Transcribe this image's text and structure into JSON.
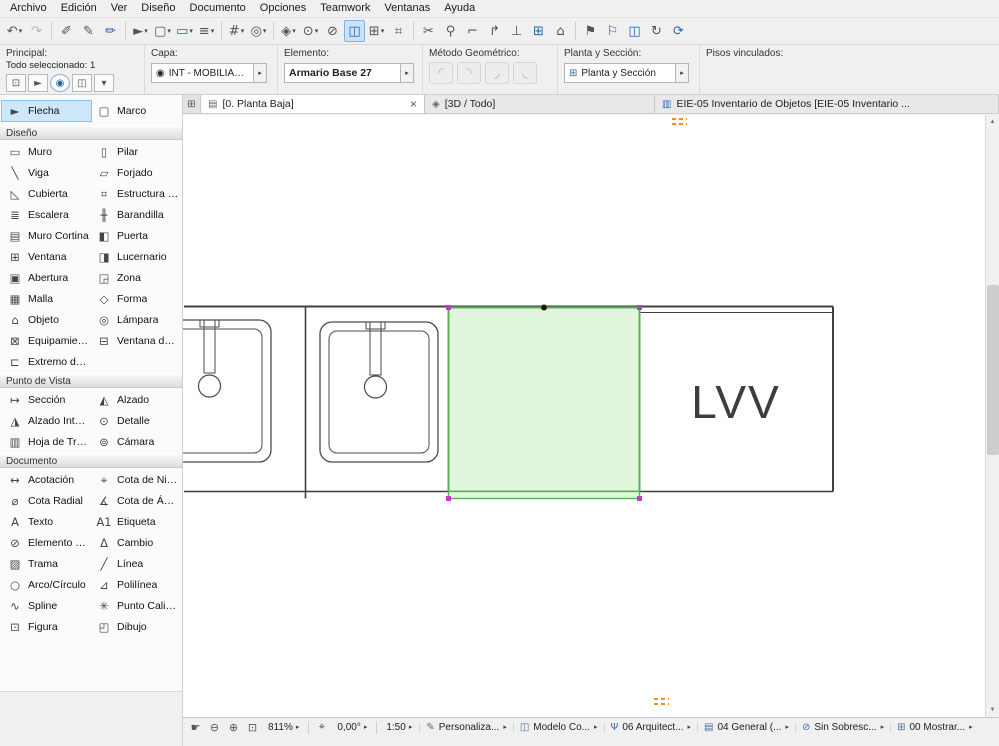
{
  "ui": {
    "caret_down": "▾",
    "caret_right": "▸",
    "close": "×",
    "scroll_up": "▲",
    "scroll_down": "▼"
  },
  "colors": {
    "selection_fill": "#E2F6DE",
    "selection_stroke": "#57AF57",
    "handle": "#C937C9",
    "toolbar_accent": "#2464a4",
    "story_marker": "#FF8C1A"
  },
  "menu": {
    "items": [
      {
        "name": "menu-archivo",
        "label": "Archivo"
      },
      {
        "name": "menu-edicion",
        "label": "Edición"
      },
      {
        "name": "menu-ver",
        "label": "Ver"
      },
      {
        "name": "menu-diseno",
        "label": "Diseño"
      },
      {
        "name": "menu-documento",
        "label": "Documento"
      },
      {
        "name": "menu-opciones",
        "label": "Opciones"
      },
      {
        "name": "menu-teamwork",
        "label": "Teamwork"
      },
      {
        "name": "menu-ventanas",
        "label": "Ventanas"
      },
      {
        "name": "menu-ayuda",
        "label": "Ayuda"
      }
    ]
  },
  "toolbar": {
    "groups": [
      [
        {
          "name": "undo-button",
          "glyph": "↶",
          "dd": true
        },
        {
          "name": "redo-button",
          "glyph": "↷",
          "dim": true
        }
      ],
      [
        {
          "name": "pick-up-parameters-button",
          "glyph": "✐"
        },
        {
          "name": "inject-parameters-button",
          "glyph": "✎"
        },
        {
          "name": "favorites-button",
          "glyph": "✏",
          "blue": true
        }
      ],
      [
        {
          "name": "arrow-tool-button",
          "glyph": "►",
          "dd": true
        },
        {
          "name": "marquee-tool-button",
          "glyph": "▢",
          "dd": true
        },
        {
          "name": "wall-tool-button",
          "glyph": "▭",
          "dd": true,
          "blue": true
        },
        {
          "name": "layer-settings-button",
          "glyph": "≡",
          "dd": true
        }
      ],
      [
        {
          "name": "grid-snap-button",
          "glyph": "#",
          "dd": true
        },
        {
          "name": "gravity-button",
          "glyph": "◎",
          "dd": true
        }
      ],
      [
        {
          "name": "projection-button",
          "glyph": "◈",
          "dd": true
        },
        {
          "name": "zoom-selection-button",
          "glyph": "⊙",
          "dd": true
        },
        {
          "name": "suspend-groups-button",
          "glyph": "⊘"
        },
        {
          "name": "element-snap-button",
          "glyph": "◫",
          "blue": true,
          "active": true
        },
        {
          "name": "guide-lines-button",
          "glyph": "⊞",
          "dd": true
        },
        {
          "name": "snap-reference-button",
          "glyph": "⌗"
        }
      ],
      [
        {
          "name": "split-button",
          "glyph": "✂"
        },
        {
          "name": "stretch-button",
          "glyph": "⚲"
        },
        {
          "name": "fillet-button",
          "glyph": "⌐"
        },
        {
          "name": "adjust-button",
          "glyph": "↱"
        },
        {
          "name": "intersect-button",
          "glyph": "⊥"
        },
        {
          "name": "new-window-button",
          "glyph": "⊞",
          "blue": true
        },
        {
          "name": "home-story-button",
          "glyph": "⌂"
        }
      ],
      [
        {
          "name": "flag-start-button",
          "glyph": "⚑"
        },
        {
          "name": "flag-review-button",
          "glyph": "⚐",
          "blue": true
        },
        {
          "name": "panel-toggle-button",
          "glyph": "◫",
          "blue": true
        },
        {
          "name": "rotate-view-button",
          "glyph": "↻"
        },
        {
          "name": "rebuild-button",
          "glyph": "⟳",
          "blue": true
        }
      ]
    ]
  },
  "infobar": {
    "principal": {
      "label": "Principal:",
      "selection": "Todo seleccionado: 1",
      "buttons": [
        {
          "name": "settings-dialog-button",
          "glyph": "⊡"
        },
        {
          "name": "pick-up-settings-button",
          "glyph": "►"
        },
        {
          "name": "default-settings-button",
          "glyph": "◉",
          "round": true
        },
        {
          "name": "favorites-popup-button",
          "glyph": "◫"
        },
        {
          "name": "more-options-button",
          "glyph": "▾"
        }
      ]
    },
    "capa": {
      "label": "Capa:",
      "icon": "◉",
      "value": "INT - MOBILIARIO FIJO.I..."
    },
    "elemento": {
      "label": "Elemento:",
      "value": "Armario Base 27"
    },
    "metodo": {
      "label": "Método Geométrico:",
      "buttons": [
        {
          "name": "geometry-method-1-button",
          "glyph": "◜"
        },
        {
          "name": "geometry-method-2-button",
          "glyph": "◝"
        },
        {
          "name": "geometry-method-3-button",
          "glyph": "◞"
        },
        {
          "name": "geometry-method-4-button",
          "glyph": "◟"
        }
      ]
    },
    "planta": {
      "label": "Planta y Sección:",
      "icon": "⊞",
      "value": "Planta y Sección"
    },
    "pisos": {
      "label": "Pisos vinculados:"
    }
  },
  "toolbox": {
    "top_tools": [
      {
        "name": "tool-flecha",
        "glyph": "►",
        "label": "Flecha",
        "selected": true
      },
      {
        "name": "tool-marco",
        "glyph": "▢",
        "label": "Marco"
      }
    ],
    "sections": [
      {
        "title": "Diseño",
        "tools": [
          {
            "name": "tool-muro",
            "glyph": "▭",
            "label": "Muro"
          },
          {
            "name": "tool-pilar",
            "glyph": "▯",
            "label": "Pilar"
          },
          {
            "name": "tool-viga",
            "glyph": "╲",
            "label": "Viga"
          },
          {
            "name": "tool-forjado",
            "glyph": "▱",
            "label": "Forjado"
          },
          {
            "name": "tool-cubierta",
            "glyph": "◺",
            "label": "Cubierta"
          },
          {
            "name": "tool-estructura-compleja",
            "glyph": "⌗",
            "label": "Estructura C..."
          },
          {
            "name": "tool-escalera",
            "glyph": "≣",
            "label": "Escalera"
          },
          {
            "name": "tool-barandilla",
            "glyph": "╫",
            "label": "Barandilla"
          },
          {
            "name": "tool-muro-cortina",
            "glyph": "▤",
            "label": "Muro Cortina"
          },
          {
            "name": "tool-puerta",
            "glyph": "◧",
            "label": "Puerta"
          },
          {
            "name": "tool-ventana",
            "glyph": "⊞",
            "label": "Ventana"
          },
          {
            "name": "tool-lucernario",
            "glyph": "◨",
            "label": "Lucernario"
          },
          {
            "name": "tool-abertura",
            "glyph": "▣",
            "label": "Abertura"
          },
          {
            "name": "tool-zona",
            "glyph": "◲",
            "label": "Zona"
          },
          {
            "name": "tool-malla",
            "glyph": "▦",
            "label": "Malla"
          },
          {
            "name": "tool-forma",
            "glyph": "◇",
            "label": "Forma"
          },
          {
            "name": "tool-objeto",
            "glyph": "⌂",
            "label": "Objeto"
          },
          {
            "name": "tool-lampara",
            "glyph": "◎",
            "label": "Lámpara"
          },
          {
            "name": "tool-equipamiento",
            "glyph": "⊠",
            "label": "Equipamiento"
          },
          {
            "name": "tool-ventana-de",
            "glyph": "⊟",
            "label": "Ventana de ..."
          },
          {
            "name": "tool-extremo-de",
            "glyph": "⊏",
            "label": "Extremo de ..."
          }
        ]
      },
      {
        "title": "Punto de Vista",
        "tools": [
          {
            "name": "tool-seccion",
            "glyph": "↦",
            "label": "Sección"
          },
          {
            "name": "tool-alzado",
            "glyph": "◭",
            "label": "Alzado"
          },
          {
            "name": "tool-alzado-interior",
            "glyph": "◮",
            "label": "Alzado Interi..."
          },
          {
            "name": "tool-detalle",
            "glyph": "⊙",
            "label": "Detalle"
          },
          {
            "name": "tool-hoja-de-trabajo",
            "glyph": "▥",
            "label": "Hoja de Trab..."
          },
          {
            "name": "tool-camara",
            "glyph": "⊚",
            "label": "Cámara"
          }
        ]
      },
      {
        "title": "Documento",
        "tools": [
          {
            "name": "tool-acotacion",
            "glyph": "↔",
            "label": "Acotación"
          },
          {
            "name": "tool-cota-de-nivel",
            "glyph": "⌖",
            "label": "Cota de Nivel"
          },
          {
            "name": "tool-cota-radial",
            "glyph": "⌀",
            "label": "Cota Radial"
          },
          {
            "name": "tool-cota-de-angulo",
            "glyph": "∡",
            "label": "Cota de Áng..."
          },
          {
            "name": "tool-texto",
            "glyph": "A",
            "label": "Texto"
          },
          {
            "name": "tool-etiqueta",
            "glyph": "A1",
            "label": "Etiqueta"
          },
          {
            "name": "tool-elemento-de",
            "glyph": "⊘",
            "label": "Elemento de..."
          },
          {
            "name": "tool-cambio",
            "glyph": "Δ",
            "label": "Cambio"
          },
          {
            "name": "tool-trama",
            "glyph": "▨",
            "label": "Trama"
          },
          {
            "name": "tool-linea",
            "glyph": "╱",
            "label": "Línea"
          },
          {
            "name": "tool-arco-circulo",
            "glyph": "○",
            "label": "Arco/Círculo"
          },
          {
            "name": "tool-polilinea",
            "glyph": "⊿",
            "label": "Polilínea"
          },
          {
            "name": "tool-spline",
            "glyph": "∿",
            "label": "Spline"
          },
          {
            "name": "tool-punto-caliente",
            "glyph": "✳",
            "label": "Punto Calien..."
          },
          {
            "name": "tool-figura",
            "glyph": "⊡",
            "label": "Figura"
          },
          {
            "name": "tool-dibujo",
            "glyph": "◰",
            "label": "Dibujo"
          }
        ]
      }
    ]
  },
  "tabs": {
    "list_icon": "⊞",
    "items": [
      {
        "name": "tab-planta-baja",
        "icon": "▤",
        "label": "[0. Planta Baja]",
        "active": true,
        "closable": true
      },
      {
        "name": "tab-3d-todo",
        "icon": "◈",
        "label": "[3D / Todo]"
      },
      {
        "name": "tab-inventario-objetos",
        "icon": "▥",
        "label": "EIE-05 Inventario de Objetos [EIE-05 Inventario ...",
        "blue_icon": true
      }
    ]
  },
  "canvas": {
    "lvv_label": "LVV"
  },
  "statusbar": {
    "pan_icon": "☛",
    "zoom_out_icon": "⊖",
    "zoom_in_icon": "⊕",
    "fit_icon": "⊡",
    "zoom_value": "811%",
    "angle_icon": "⌖",
    "angle_value": "0,00°",
    "scale_value": "1:50",
    "items": [
      {
        "name": "status-personalizar",
        "icon": "✎",
        "label": "Personaliza..."
      },
      {
        "name": "status-modelo-completo",
        "icon": "◫",
        "label": "Modelo Co..."
      },
      {
        "name": "status-combinacion-capas",
        "icon": "Ψ",
        "label": "06 Arquitect..."
      },
      {
        "name": "status-conjunto-plumas",
        "icon": "▤",
        "label": "04 General (..."
      },
      {
        "name": "status-sobrescritura",
        "icon": "⊘",
        "label": "Sin Sobresc..."
      },
      {
        "name": "status-filtro-renovacion",
        "icon": "⊞",
        "label": "00 Mostrar..."
      }
    ]
  }
}
